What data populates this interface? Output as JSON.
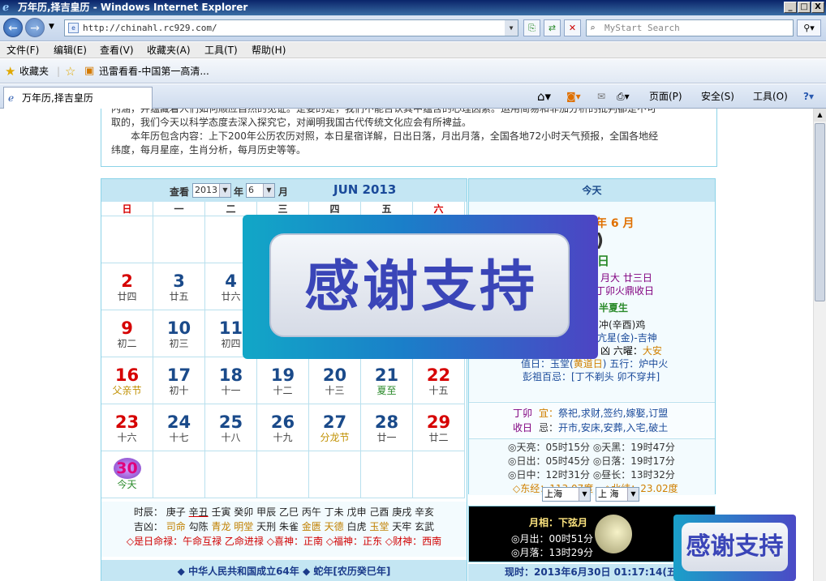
{
  "window": {
    "title": "万年历,择吉皇历 - Windows Internet Explorer",
    "min": "_",
    "max": "□",
    "close": "X"
  },
  "addressbar": {
    "url": "http://chinahl.rc929.com/",
    "search_placeholder": "MyStart Search"
  },
  "menu": [
    "文件(F)",
    "编辑(E)",
    "查看(V)",
    "收藏夹(A)",
    "工具(T)",
    "帮助(H)"
  ],
  "favorites": {
    "label": "收藏夹",
    "item": "迅雷看看-中国第一高清..."
  },
  "tab": {
    "title": "万年历,择吉皇历"
  },
  "commands": {
    "page": "页面(P)",
    "safety": "安全(S)",
    "tools": "工具(O)"
  },
  "intro": {
    "line1": "内涵，并蕴藏着人们如何顺应自然的见证。是要的是，我们不能否认其中蕴含的心理因素。运用简易和非加分析的批判都是不可",
    "line2": "取的，我们今天以科学态度去深入探究它，对阐明我国古代传统文化应会有所裨益。",
    "line3": "本年历包含内容：上下200年公历农历对照，本日星宿详解，日出日落，月出月落，全国各地72小时天气预报，全国各地经",
    "line4": "纬度，每月星座，生肖分析，每月历史等等。"
  },
  "calendar": {
    "view_label": "查看",
    "year": "2013",
    "year_unit": "年",
    "month": "6",
    "month_unit": "月",
    "month_title": "JUN 2013",
    "weekdays": [
      "日",
      "一",
      "二",
      "三",
      "四",
      "五",
      "六"
    ],
    "days": [
      {
        "d": "2",
        "l": "廿四"
      },
      {
        "d": "3",
        "l": "廿五"
      },
      {
        "d": "4",
        "l": "廿六"
      },
      {
        "d": "9",
        "l": "初二"
      },
      {
        "d": "10",
        "l": "初三"
      },
      {
        "d": "11",
        "l": "初四"
      },
      {
        "d": "16",
        "l": "父亲节"
      },
      {
        "d": "17",
        "l": "初十"
      },
      {
        "d": "18",
        "l": "十一"
      },
      {
        "d": "19",
        "l": "十二"
      },
      {
        "d": "20",
        "l": "十三"
      },
      {
        "d": "21",
        "l": "夏至"
      },
      {
        "d": "22",
        "l": "十五"
      },
      {
        "d": "23",
        "l": "十六"
      },
      {
        "d": "24",
        "l": "十七"
      },
      {
        "d": "25",
        "l": "十八"
      },
      {
        "d": "26",
        "l": "十九"
      },
      {
        "d": "27",
        "l": "分龙节"
      },
      {
        "d": "28",
        "l": "廿一"
      },
      {
        "d": "29",
        "l": "廿二"
      },
      {
        "d": "30",
        "l": "今天"
      }
    ],
    "hours_label": "时辰：",
    "hours": [
      "庚子",
      "辛丑",
      "壬寅",
      "癸卯",
      "甲辰",
      "乙巳",
      "丙午",
      "丁未",
      "戊申",
      "己酉",
      "庚戌",
      "辛亥"
    ],
    "gods": [
      "吉凶：",
      "司命",
      "勾陈",
      "青龙",
      "明堂",
      "天刑",
      "朱雀",
      "金匮",
      "天德",
      "白虎",
      "玉堂",
      "天牢",
      "玄武"
    ],
    "lucky": [
      "◇是日命禄：午命互禄",
      "乙命进禄",
      "◇喜神：正南",
      "◇福神：正东",
      "◇财神：西南"
    ],
    "footer": "◆ 中华人民共和国成立64年  ◆ 蛇年[农历癸巳年]"
  },
  "today": {
    "header": "今天",
    "month_frag": "年 6 月",
    "day_frag": ")",
    "day_char": "日",
    "lunar1": "月大  廿三日",
    "lunar2": "丁卯火鼎收日",
    "term": "半夏生",
    "shen": "冲(辛酉)鸡",
    "star": "亢星(金)-吉神",
    "liuyao_a": "凶  六曜：",
    "liuyao_b": "大安",
    "zhishen_a": "值日：玉堂(",
    "zhishen_b": "黄道日",
    "zhishen_c": ") 五行：炉中火",
    "pengzu": "彭祖百忌：[丁不剃头 卯不穿井]",
    "yi_left": "丁卯",
    "yi_label": "宜：",
    "yi": "祭祀,求财,签约,嫁娶,订盟",
    "ji_left": "收日",
    "ji_label": "忌：",
    "ji": "开市,安床,安葬,入宅,破土",
    "sun": [
      "◎天亮：05时15分  ◎天黑：19时47分",
      "◎日出：05时45分  ◎日落：19时17分",
      "◎日中：12时31分  ◎昼长：13时32分"
    ],
    "lon": "◇东经：113.07度",
    "lat": "◇北纬：23.02度",
    "province": "上海",
    "city": "上 海",
    "moon_phase": "月相：下弦月",
    "moonrise": "◎月出：00时51分",
    "moonset": "◎月落：13时29分",
    "now": "现时：2013年6月30日 01:17:14(五"
  },
  "overlay": {
    "text": "感谢支持",
    "text_small": "感谢支持"
  }
}
